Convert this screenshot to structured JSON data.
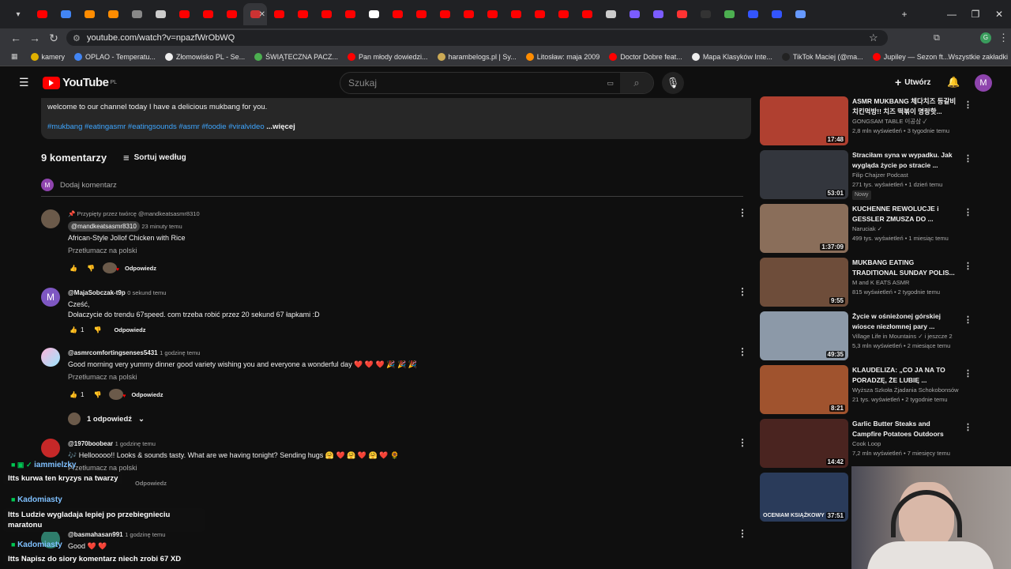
{
  "browser": {
    "url": "youtube.com/watch?v=npazfWrObWQ",
    "tab_colors": [
      "#ff0000",
      "#4285f4",
      "#ff8c00",
      "#ff8c00",
      "#888888",
      "#cccccc",
      "#ff0000",
      "#ff0000",
      "#ff0000",
      "#cc3333",
      "#ff0000",
      "#ff0000",
      "#ff0000",
      "#ff0000",
      "#ffffff",
      "#ff0000",
      "#ff0000",
      "#ff0000",
      "#ff0000",
      "#ff0000",
      "#ff0000",
      "#ff0000",
      "#ff0000",
      "#ff0000",
      "#cccccc",
      "#7b5cff",
      "#7b5cff",
      "#ff3333",
      "#333333",
      "#4caf50",
      "#3355ff",
      "#3355ff",
      "#6699ff"
    ],
    "bookmarks": [
      {
        "label": "kamery",
        "color": "#e0b000"
      },
      {
        "label": "OPLAO - Temperatu...",
        "color": "#4285f4"
      },
      {
        "label": "Złomowisko PL - Se...",
        "color": "#eeeeee"
      },
      {
        "label": "ŚWIĄTECZNA PACZ...",
        "color": "#4caf50"
      },
      {
        "label": "Pan młody dowiedzi...",
        "color": "#ff0000"
      },
      {
        "label": "harambelogs.pl | Sy...",
        "color": "#ccaa55"
      },
      {
        "label": "Litosław: maja 2009",
        "color": "#ff8c00"
      },
      {
        "label": "Doctor Dobre feat...",
        "color": "#ff0000"
      },
      {
        "label": "Mapa Klasyków Inte...",
        "color": "#eeeeee"
      },
      {
        "label": "TikTok Maciej (@ma...",
        "color": "#222222"
      },
      {
        "label": "Jupiley — Sezon ft...",
        "color": "#ff0000"
      }
    ],
    "all_bookmarks": "Wszystkie zakładki"
  },
  "header": {
    "logo": "YouTube",
    "region": "PL",
    "search_placeholder": "Szukaj",
    "create": "Utwórz",
    "avatar": "M"
  },
  "description": {
    "line": "welcome to our channel today I have a delicious mukbang for you.",
    "tags": "#mukbang #eatingasmr #eatingsounds #asmr #foodie #viralvideo",
    "more": "...więcej"
  },
  "comments_header": {
    "count": "9 komentarzy",
    "sort": "Sortuj według",
    "add": "Dodaj komentarz",
    "add_avatar": "M"
  },
  "comments": [
    {
      "pinned": "Przypięty przez twórcę @mandkeatsasmr8310",
      "author": "@mandkeatsasmr8310",
      "time": "23 minuty temu",
      "text": "African-Style Jollof Chicken with Rice",
      "translate": "Przetłumacz na polski",
      "likes": "",
      "reply": "Odpowiedz"
    },
    {
      "author": "@MajaSobczak-t9p",
      "time": "0 sekund temu",
      "text": "Cześć,",
      "text2": "Dołaczycie do trendu 67speed. com trzeba robić przez 20 sekund 67 łapkami :D",
      "likes": "1",
      "reply": "Odpowiedz",
      "avatar": "M"
    },
    {
      "author": "@asmrcomfortingsenses5431",
      "time": "1 godzinę temu",
      "text": "Good morning very yummy dinner good variety wishing you and everyone a wonderful day ❤️ ❤️ ❤️ 🎉 🎉 🎉",
      "translate": "Przetłumacz na polski",
      "likes": "1",
      "reply": "Odpowiedz",
      "replies": "1 odpowiedź"
    },
    {
      "author": "@1970boobear",
      "time": "1 godzinę temu",
      "text": "🎶 Hellooooo!! Looks & sounds tasty. What are we having tonight? Sending hugs 🤗 ❤️ 🤗 ❤️ 🤗 ❤️ 🌻",
      "translate": "Przetłumacz na polski",
      "reply": "Odpowiedz"
    },
    {
      "author": "@basmahasan991",
      "time": "1 godzinę temu",
      "text": "Good ❤️ ❤️"
    }
  ],
  "sidebar": [
    {
      "title": "ASMR MUKBANG 체다치즈 등갈비 치킨먹방!! 치즈 떡볶이 명랑핫...",
      "channel": "GONGSAM TABLE 이공삼 ✓",
      "meta": "2,8 mln wyświetleń • 3 tygodnie temu",
      "duration": "17:48",
      "color": "#b04030"
    },
    {
      "title": "Straciłam syna w wypadku. Jak wygląda życie po stracie ...",
      "channel": "Filip Chajzer Podcast",
      "meta": "271 tys. wyświetleń • 1 dzień temu",
      "badge": "Nowy",
      "duration": "53:01",
      "color": "#33363d"
    },
    {
      "title": "KUCHENNE REWOLUCJE i GESSLER ZMUSZA DO ...",
      "channel": "Naruciak ✓",
      "meta": "499 tys. wyświetleń • 1 miesiąc temu",
      "duration": "1:37:09",
      "color": "#8a6e5a"
    },
    {
      "title": "MUKBANG EATING TRADITIONAL SUNDAY POLIS...",
      "channel": "M and K EATS ASMR",
      "meta": "815 wyświetleń • 2 tygodnie temu",
      "duration": "9:55",
      "color": "#6e4d3a"
    },
    {
      "title": "Życie w ośnieżonej górskiej wiosce niezłomnej pary ...",
      "channel": "Village Life in Mountains ✓ i jeszcze 2",
      "meta": "5,3 mln wyświetleń • 2 miesiące temu",
      "duration": "49:35",
      "color": "#8c99a8"
    },
    {
      "title": "KLAUDELIZA: „CO JA NA TO PORADZĘ, ŻE LUBIĘ ...",
      "channel": "Wyższa Szkoła Żjadania Schokobonsów",
      "meta": "21 tys. wyświetleń • 2 tygodnie temu",
      "duration": "8:21",
      "color": "#a0532e"
    },
    {
      "title": "Garlic Butter Steaks and Campfire Potatoes Outdoors",
      "channel": "Cook Loop",
      "meta": "7,2 mln wyświetleń • 7 miesięcy temu",
      "duration": "14:42",
      "color": "#4a2420"
    },
    {
      "title": "",
      "channel": "",
      "meta": "",
      "duration": "37:51",
      "color": "#2a3b5a",
      "overlay": "OCENIAM KSIĄŻKOWY"
    }
  ],
  "stream_chat": [
    {
      "name": "iammielzky",
      "msg": "Itts kurwa ten kryzys na twarzy"
    },
    {
      "name": "Kadomiasty",
      "msg": "Itts Ludzie wygladaja lepiej po przebiegnieciu maratonu"
    },
    {
      "name": "Kadomiasty",
      "msg": "Itts Napisz do siory komentarz niech zrobi 67 XD"
    }
  ]
}
